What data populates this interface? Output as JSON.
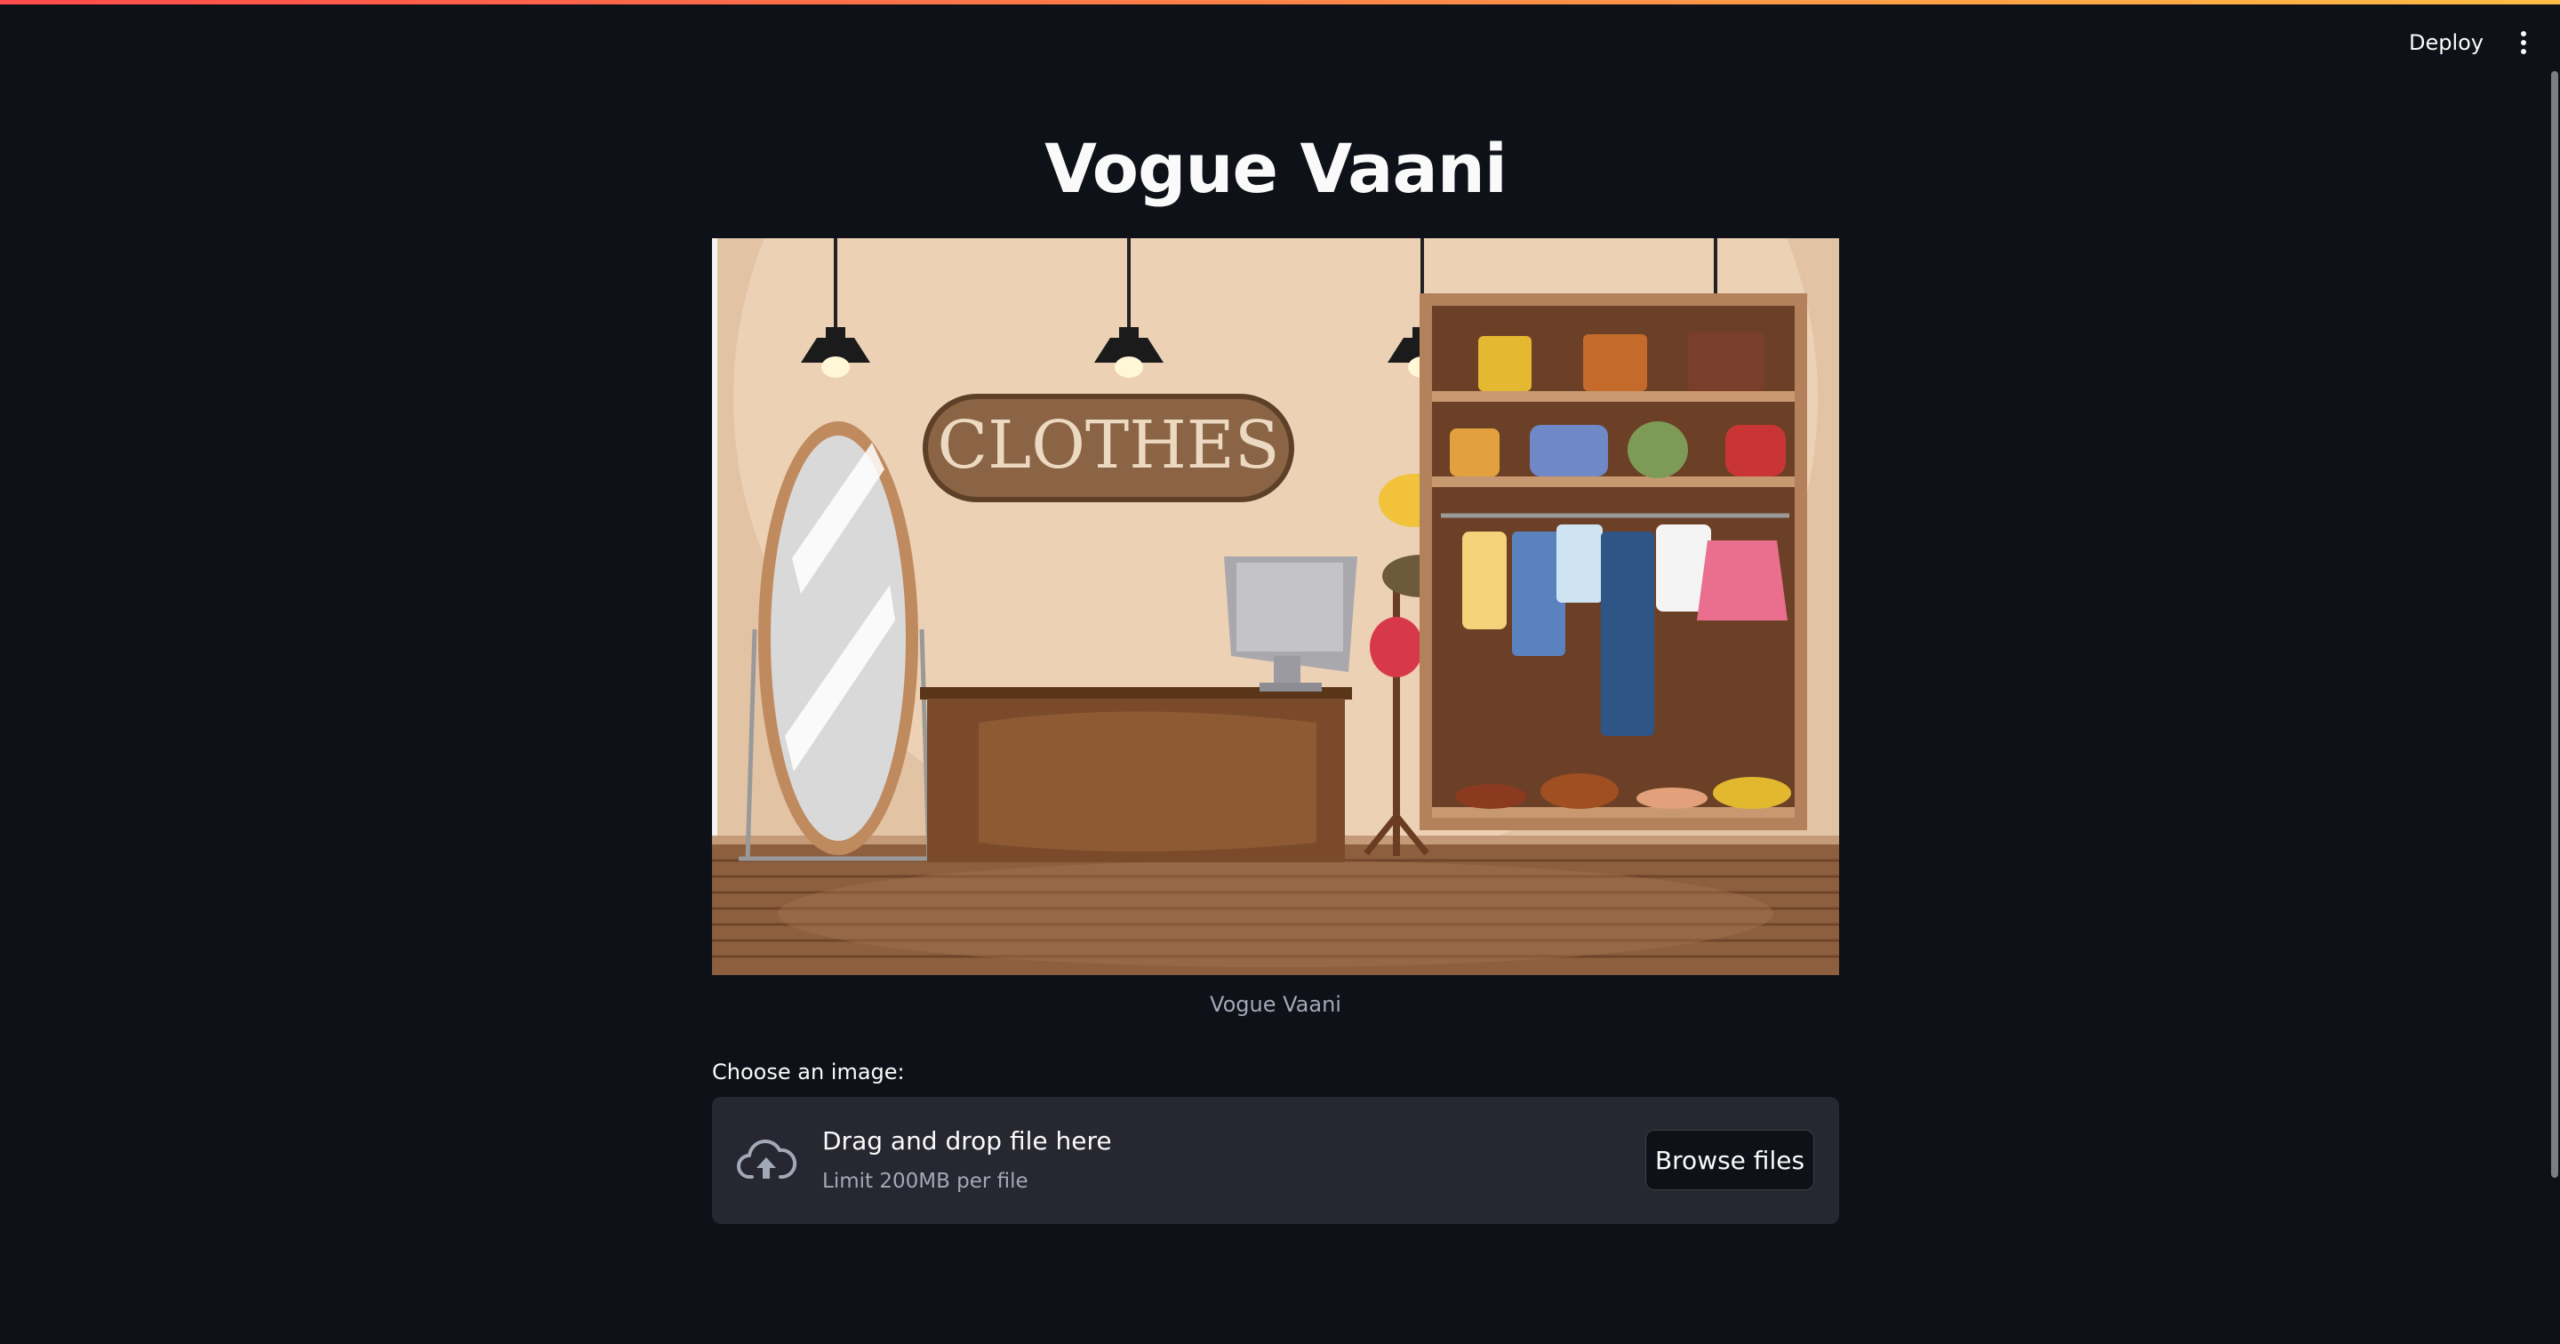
{
  "header": {
    "deploy_label": "Deploy",
    "menu_icon": "vertical-ellipsis-icon"
  },
  "main": {
    "title": "Vogue Vaani",
    "image": {
      "sign_text": "CLOTHES",
      "caption": "Vogue Vaani"
    },
    "uploader": {
      "label": "Choose an image:",
      "icon": "cloud-upload-icon",
      "drop_text": "Drag and drop file here",
      "limit_text": "Limit 200MB per file",
      "browse_label": "Browse files"
    }
  },
  "colors": {
    "background": "#0e1117",
    "dropzone": "#262730",
    "accent_start": "#ff4b4b",
    "accent_end": "#ffbd45"
  }
}
